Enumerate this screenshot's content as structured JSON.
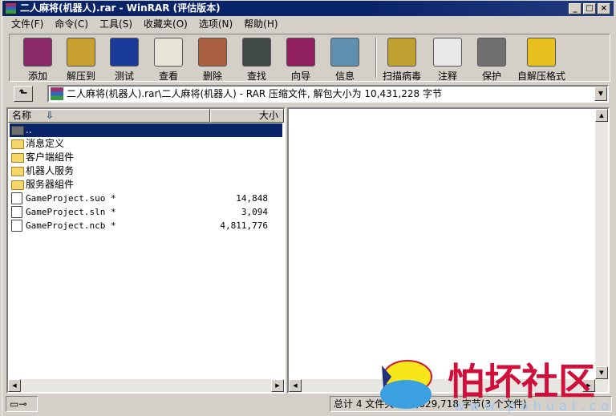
{
  "window": {
    "title": "二人麻将(机器人).rar - WinRAR (评估版本)",
    "minimize": "_",
    "maximize": "□",
    "close": "×"
  },
  "menu": [
    "文件(F)",
    "命令(C)",
    "工具(S)",
    "收藏夹(O)",
    "选项(N)",
    "帮助(H)"
  ],
  "toolbar": [
    {
      "label": "添加",
      "icon": "add-archive-icon",
      "color": "#8a2a6a"
    },
    {
      "label": "解压到",
      "icon": "extract-to-icon",
      "color": "#c8a030"
    },
    {
      "label": "测试",
      "icon": "test-icon",
      "color": "#1a3a9a"
    },
    {
      "label": "查看",
      "icon": "view-icon",
      "color": "#e8e4d8"
    },
    {
      "label": "删除",
      "icon": "delete-icon",
      "color": "#a86040"
    },
    {
      "label": "查找",
      "icon": "find-icon",
      "color": "#404848"
    },
    {
      "label": "向导",
      "icon": "wizard-icon",
      "color": "#902060"
    },
    {
      "label": "信息",
      "icon": "info-icon",
      "color": "#6090b0"
    },
    {
      "label": "扫描病毒",
      "icon": "virus-scan-icon",
      "color": "#c0a030"
    },
    {
      "label": "注释",
      "icon": "comment-icon",
      "color": "#e8e8e8"
    },
    {
      "label": "保护",
      "icon": "protect-icon",
      "color": "#707070"
    },
    {
      "label": "自解压格式",
      "icon": "sfx-icon",
      "color": "#e8c020"
    }
  ],
  "address": {
    "up": "⬑",
    "path": "二人麻将(机器人).rar\\二人麻将(机器人) - RAR 压缩文件, 解包大小为 10,431,228 字节"
  },
  "list": {
    "col_name": "名称",
    "col_size": "大小",
    "sort_arrow": "⇩",
    "rows": [
      {
        "name": "..",
        "size": "",
        "type": "parent"
      },
      {
        "name": "消息定义",
        "size": "",
        "type": "folder"
      },
      {
        "name": "客户端組件",
        "size": "",
        "type": "folder"
      },
      {
        "name": "机器人服务",
        "size": "",
        "type": "folder"
      },
      {
        "name": "服务器組件",
        "size": "",
        "type": "folder"
      },
      {
        "name": "GameProject.suo *",
        "size": "14,848",
        "type": "file"
      },
      {
        "name": "GameProject.sln *",
        "size": "3,094",
        "type": "file"
      },
      {
        "name": "GameProject.ncb *",
        "size": "4,811,776",
        "type": "file"
      }
    ]
  },
  "status": {
    "summary": "总计 4 文件夹 和 4,829,718 字节(3 个文件)"
  },
  "watermark": {
    "text": "怕坏社区",
    "url": "www.pohuai.com"
  },
  "colors": {
    "titlebar": "#0a246a",
    "selection": "#0a246a",
    "chrome": "#d4d0c8"
  }
}
